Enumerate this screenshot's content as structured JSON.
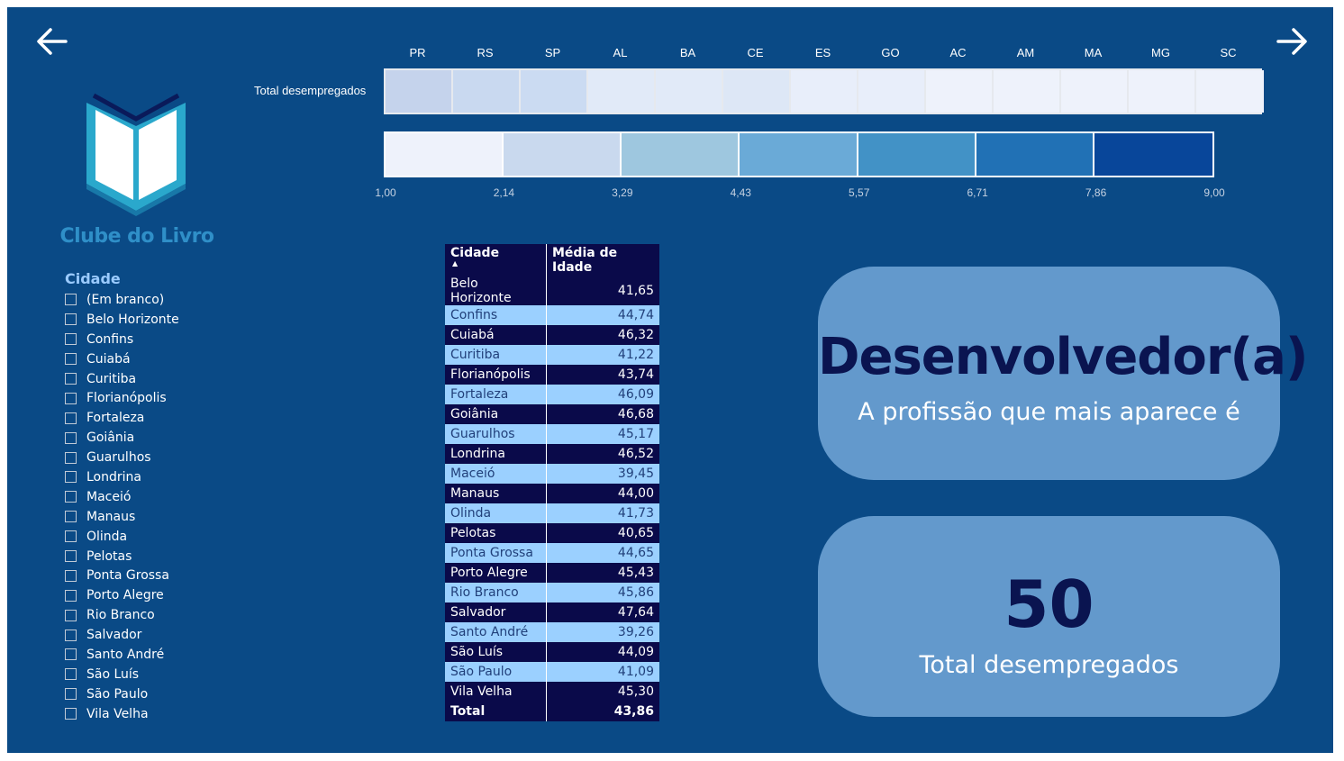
{
  "nav": {
    "back_icon": "arrow-left-icon",
    "forward_icon": "arrow-right-icon"
  },
  "logo": {
    "text": "Clube do Livro",
    "icon": "open-book-icon"
  },
  "heatmap": {
    "row_label": "Total desempregados",
    "states": [
      "PR",
      "RS",
      "SP",
      "AL",
      "BA",
      "CE",
      "ES",
      "GO",
      "AC",
      "AM",
      "MA",
      "MG",
      "SC"
    ],
    "colors": [
      "#c5d3ec",
      "#c9d9f0",
      "#cbdbf2",
      "#e1eaf8",
      "#e1eaf8",
      "#dde7f6",
      "#e8eefa",
      "#e8eefa",
      "#eef2fb",
      "#eef2fb",
      "#eef2fb",
      "#eef2fb",
      "#eef2fb"
    ]
  },
  "legend": {
    "ticks": [
      "1,00",
      "2,14",
      "3,29",
      "4,43",
      "5,57",
      "6,71",
      "7,86",
      "9,00"
    ],
    "colors": [
      "#eef2fb",
      "#c9d9ee",
      "#9ec7df",
      "#6aaad7",
      "#4292c6",
      "#2171b5",
      "#08469a"
    ]
  },
  "slicer": {
    "title": "Cidade",
    "items": [
      "(Em branco)",
      "Belo Horizonte",
      "Confins",
      "Cuiabá",
      "Curitiba",
      "Florianópolis",
      "Fortaleza",
      "Goiânia",
      "Guarulhos",
      "Londrina",
      "Maceió",
      "Manaus",
      "Olinda",
      "Pelotas",
      "Ponta Grossa",
      "Porto Alegre",
      "Rio Branco",
      "Salvador",
      "Santo André",
      "São Luís",
      "São Paulo",
      "Vila Velha"
    ]
  },
  "table": {
    "columns": [
      "Cidade",
      "Média de Idade"
    ],
    "sort_indicator": "▲",
    "rows": [
      {
        "city": "Belo Horizonte",
        "age": "41,65"
      },
      {
        "city": "Confins",
        "age": "44,74"
      },
      {
        "city": "Cuiabá",
        "age": "46,32"
      },
      {
        "city": "Curitiba",
        "age": "41,22"
      },
      {
        "city": "Florianópolis",
        "age": "43,74"
      },
      {
        "city": "Fortaleza",
        "age": "46,09"
      },
      {
        "city": "Goiânia",
        "age": "46,68"
      },
      {
        "city": "Guarulhos",
        "age": "45,17"
      },
      {
        "city": "Londrina",
        "age": "46,52"
      },
      {
        "city": "Maceió",
        "age": "39,45"
      },
      {
        "city": "Manaus",
        "age": "44,00"
      },
      {
        "city": "Olinda",
        "age": "41,73"
      },
      {
        "city": "Pelotas",
        "age": "40,65"
      },
      {
        "city": "Ponta Grossa",
        "age": "44,65"
      },
      {
        "city": "Porto Alegre",
        "age": "45,43"
      },
      {
        "city": "Rio Branco",
        "age": "45,86"
      },
      {
        "city": "Salvador",
        "age": "47,64"
      },
      {
        "city": "Santo André",
        "age": "39,26"
      },
      {
        "city": "São Luís",
        "age": "44,09"
      },
      {
        "city": "São Paulo",
        "age": "41,09"
      },
      {
        "city": "Vila Velha",
        "age": "45,30"
      }
    ],
    "total": {
      "label": "Total",
      "age": "43,86"
    }
  },
  "card_profession": {
    "value": "Desenvolvedor(a)",
    "caption": "A profissão que mais aparece é"
  },
  "card_total": {
    "value": "50",
    "caption": "Total desempregados"
  }
}
